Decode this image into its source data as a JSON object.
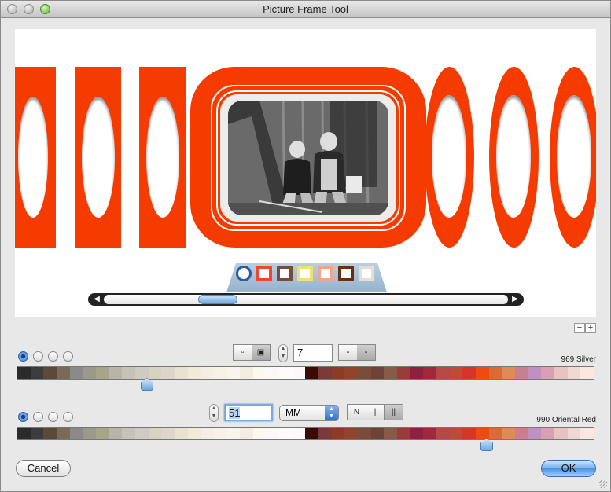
{
  "window": {
    "title": "Picture Frame Tool"
  },
  "preview": {
    "frame_color": "#f53b00",
    "mini_swatches": [
      {
        "name": "selected-oval",
        "color": "#ffffff"
      },
      {
        "name": "orange-red",
        "color": "#e84a2a"
      },
      {
        "name": "brown",
        "color": "#7a4a3a"
      },
      {
        "name": "yellow",
        "color": "#f3e06a"
      },
      {
        "name": "salmon",
        "color": "#f0a48c"
      },
      {
        "name": "dark-brown",
        "color": "#6b2d14"
      },
      {
        "name": "beige",
        "color": "#e7ddd5"
      }
    ]
  },
  "controls": {
    "zoom_out": "−",
    "zoom_in": "+",
    "row1": {
      "width_value": "7",
      "color_name": "969 Silver",
      "selected_index": 0
    },
    "row2": {
      "width_value": "51",
      "unit": "MM",
      "style_labels": [
        "N",
        "|",
        "||"
      ],
      "color_name": "990 Oriental Red",
      "selected_index": 0
    },
    "palette": [
      "#2b2b2b",
      "#3c3c3c",
      "#5b4a3a",
      "#7b6a58",
      "#8a8a8a",
      "#9a9a8a",
      "#a7a48c",
      "#b8b5a8",
      "#c5c2b8",
      "#cfcbc2",
      "#d8d2c0",
      "#dcd7c8",
      "#e8e2d0",
      "#f0ebd9",
      "#f4efe2",
      "#f6f2e8",
      "#f8f5ee",
      "#f4eee0",
      "#faf8ef",
      "#fbf9f5",
      "#fdfcfa",
      "#fcfaf8",
      "#3a0a05",
      "#7a3a3a",
      "#8e3a24",
      "#92442a",
      "#7a4a3a",
      "#6e4236",
      "#8a5a48",
      "#9a3a3a",
      "#8e2040",
      "#a02838",
      "#b84848",
      "#c04a36",
      "#d8342a",
      "#f04a10",
      "#dc6a32",
      "#e08a58",
      "#c88090",
      "#c090c0",
      "#d8a0b0",
      "#e8c4c0",
      "#f0d8d0",
      "#fae8e0"
    ],
    "cancel_label": "Cancel",
    "ok_label": "OK"
  }
}
